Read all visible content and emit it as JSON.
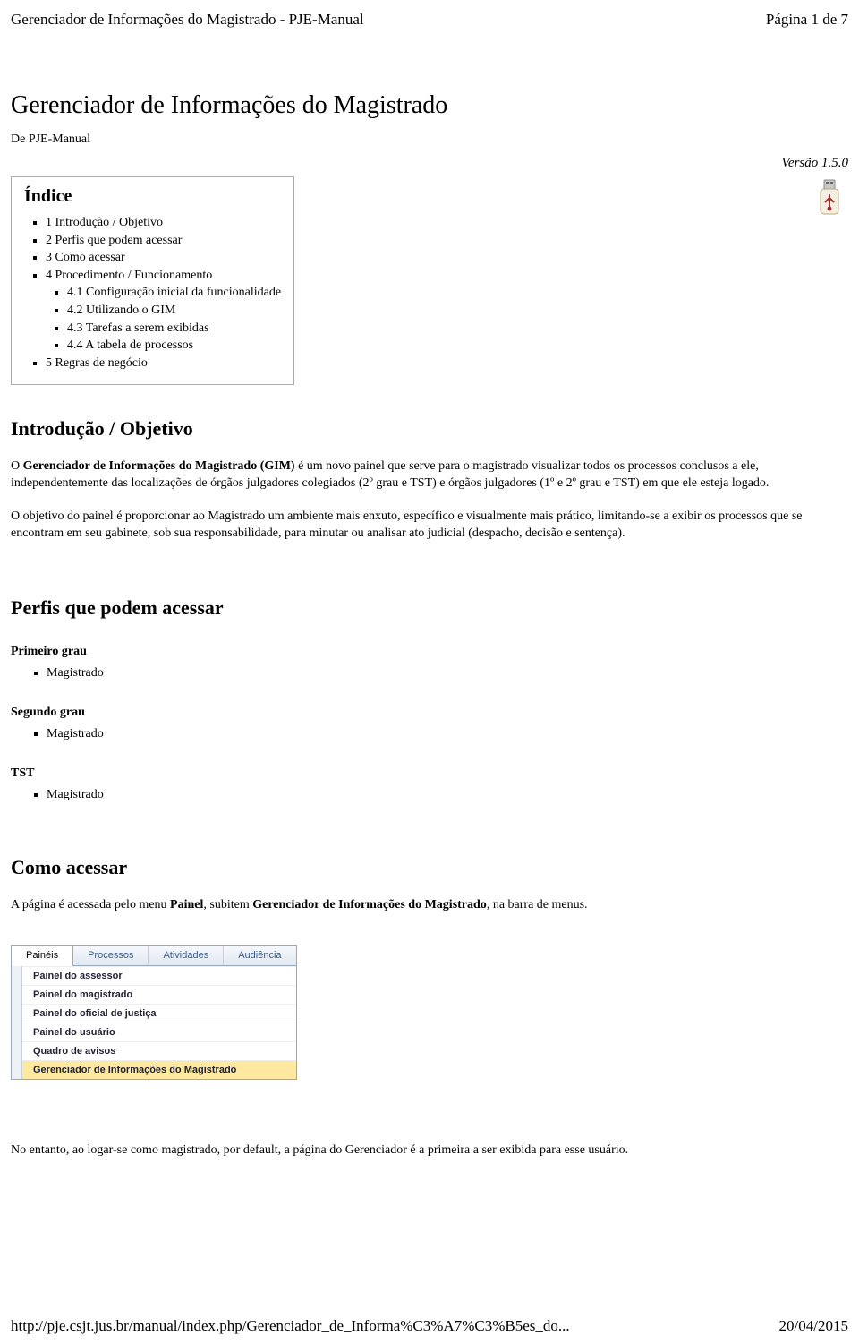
{
  "header": {
    "left": "Gerenciador de Informações do Magistrado - PJE-Manual",
    "right": "Página 1 de 7"
  },
  "title": "Gerenciador de Informações do Magistrado",
  "subtitle": "De PJE-Manual",
  "version": "Versão 1.5.0",
  "index": {
    "title": "Índice",
    "items": {
      "i1": "1 Introdução / Objetivo",
      "i2": "2 Perfis que podem acessar",
      "i3": "3 Como acessar",
      "i4": "4 Procedimento / Funcionamento",
      "i4_1": "4.1 Configuração inicial da funcionalidade",
      "i4_2": "4.2 Utilizando o GIM",
      "i4_3": "4.3 Tarefas a serem exibidas",
      "i4_4": "4.4 A tabela de processos",
      "i5": "5 Regras de negócio"
    }
  },
  "sections": {
    "intro_title": "Introdução / Objetivo",
    "intro_p1_a": "O ",
    "intro_p1_b": "Gerenciador de Informações do Magistrado (GIM)",
    "intro_p1_c": " é um novo painel que serve para o magistrado visualizar todos os processos conclusos a ele, independentemente das localizações de órgãos julgadores colegiados (2º grau e TST) e órgãos julgadores (1º e 2º grau e TST) em que ele esteja logado.",
    "intro_p2": "O objetivo do painel é proporcionar ao Magistrado um ambiente mais enxuto, específico e visualmente mais prático, limitando-se a exibir os processos que se encontram em seu gabinete, sob sua responsabilidade, para minutar ou analisar ato judicial (despacho, decisão e sentença).",
    "perfis_title": "Perfis que podem acessar",
    "primeiro": "Primeiro grau",
    "segundo": "Segundo grau",
    "tst": "TST",
    "magistrado": "Magistrado",
    "como_title": "Como acessar",
    "como_p1_a": "A página é acessada pelo menu ",
    "como_p1_b": "Painel",
    "como_p1_c": ", subitem ",
    "como_p1_d": "Gerenciador de Informações do Magistrado",
    "como_p1_e": ", na barra de menus.",
    "como_p2": "No entanto, ao logar-se como magistrado, por default, a página do Gerenciador é a primeira a ser exibida para esse usuário."
  },
  "menu": {
    "tabs": {
      "t1": "Painéis",
      "t2": "Processos",
      "t3": "Atividades",
      "t4": "Audiência"
    },
    "items": {
      "m1": "Painel do assessor",
      "m2": "Painel do magistrado",
      "m3": "Painel do oficial de justiça",
      "m4": "Painel do usuário",
      "m5": "Quadro de avisos",
      "m6": "Gerenciador de Informações do Magistrado"
    }
  },
  "footer": {
    "url": "http://pje.csjt.jus.br/manual/index.php/Gerenciador_de_Informa%C3%A7%C3%B5es_do...",
    "date": "20/04/2015"
  }
}
